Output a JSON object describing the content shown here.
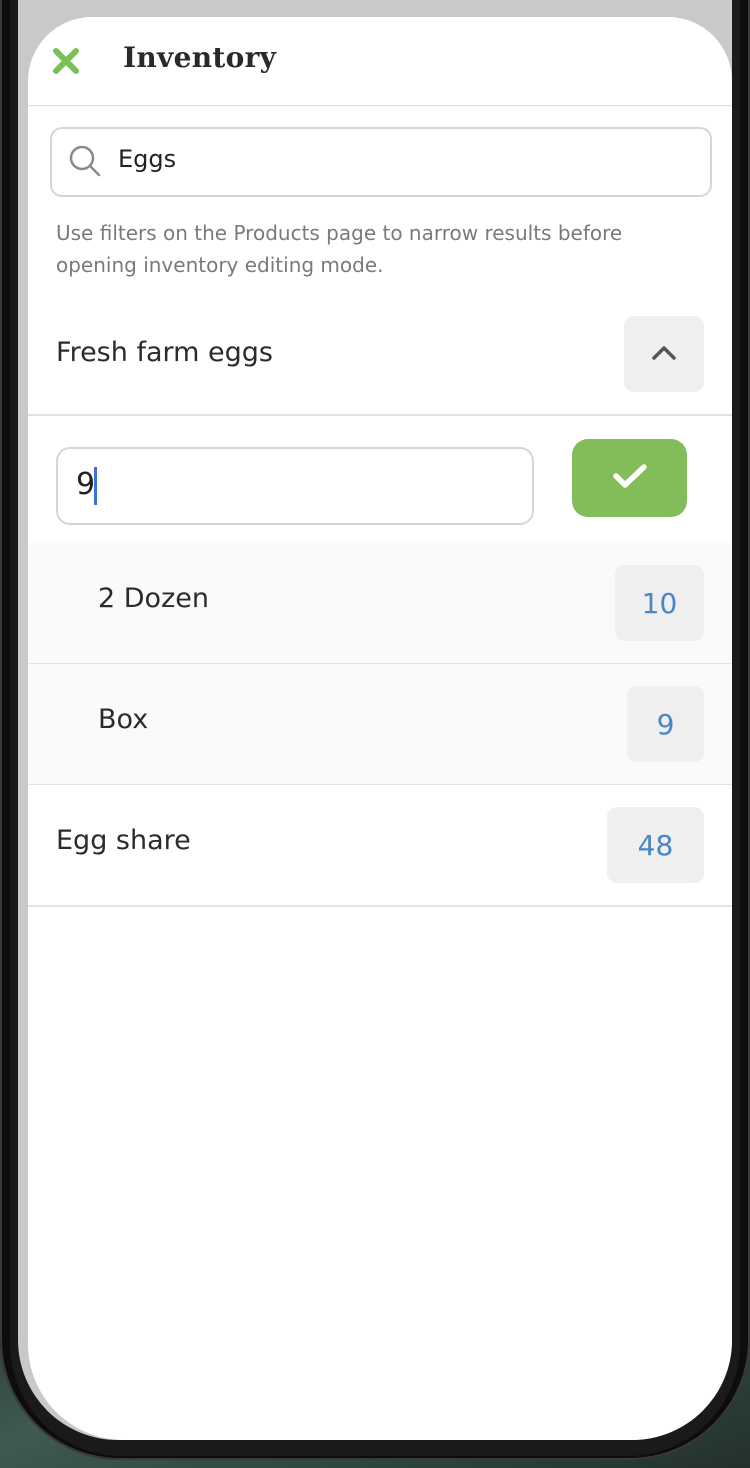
{
  "header": {
    "title": "Inventory"
  },
  "search": {
    "value": "Eggs"
  },
  "hint": "Use filters on the Products page to narrow results before opening inventory editing mode.",
  "products": [
    {
      "name": "Fresh farm eggs",
      "expanded": true,
      "edit_value": "9",
      "variants": [
        {
          "name": "2 Dozen",
          "quantity": "10"
        },
        {
          "name": "Box",
          "quantity": "9"
        }
      ]
    },
    {
      "name": "Egg share",
      "quantity": "48"
    }
  ],
  "colors": {
    "accent": "#82bd5a",
    "quantity_text": "#4a86c5",
    "close_icon": "#7cbf55"
  },
  "icons": {
    "close": "close-icon",
    "search": "search-icon",
    "collapse": "chevron-up-icon",
    "confirm": "check-icon"
  }
}
